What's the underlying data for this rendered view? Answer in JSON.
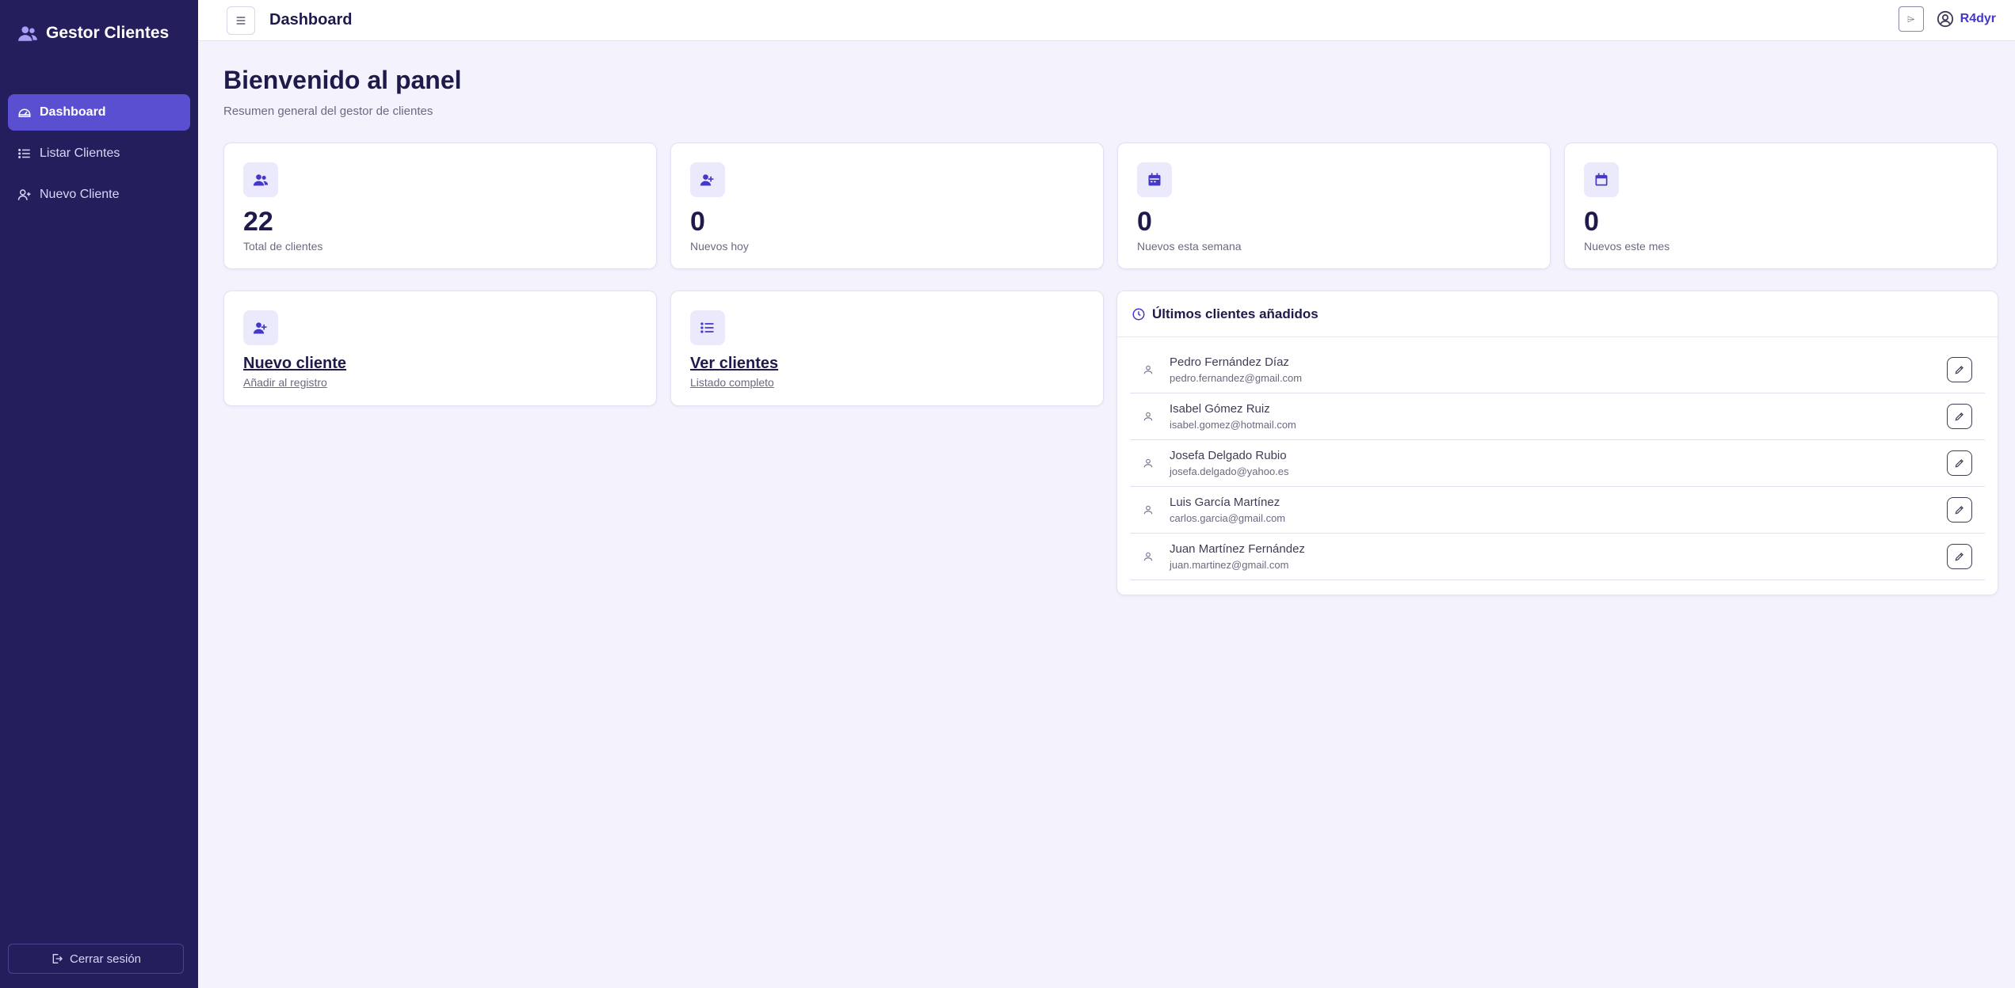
{
  "app": {
    "brand": "Gestor Clientes"
  },
  "sidebar": {
    "items": [
      {
        "label": "Dashboard",
        "icon": "dashboard-icon",
        "active": true
      },
      {
        "label": "Listar Clientes",
        "icon": "list-icon",
        "active": false
      },
      {
        "label": "Nuevo Cliente",
        "icon": "user-plus-icon",
        "active": false
      }
    ],
    "logout_label": "Cerrar sesión"
  },
  "topbar": {
    "title": "Dashboard",
    "small_button_label": "⌲",
    "user_name": "R4dyr"
  },
  "main": {
    "title": "Bienvenido al panel",
    "subtitle": "Resumen general del gestor de clientes",
    "stats": [
      {
        "value": "22",
        "label": "Total de clientes",
        "icon": "users-icon"
      },
      {
        "value": "0",
        "label": "Nuevos hoy",
        "icon": "user-plus-icon"
      },
      {
        "value": "0",
        "label": "Nuevos esta semana",
        "icon": "calendar-week-icon"
      },
      {
        "value": "0",
        "label": "Nuevos este mes",
        "icon": "calendar-month-icon"
      }
    ],
    "actions": [
      {
        "title": "Nuevo cliente",
        "subtitle": "Añadir al registro",
        "icon": "user-plus-icon"
      },
      {
        "title": "Ver clientes",
        "subtitle": "Listado completo",
        "icon": "list-icon"
      }
    ],
    "recent": {
      "title": "Últimos clientes añadidos",
      "clients": [
        {
          "name": "Pedro Fernández Díaz",
          "email": "pedro.fernandez@gmail.com"
        },
        {
          "name": "Isabel Gómez Ruiz",
          "email": "isabel.gomez@hotmail.com"
        },
        {
          "name": "Josefa Delgado Rubio",
          "email": "josefa.delgado@yahoo.es"
        },
        {
          "name": "Luis García Martínez",
          "email": "carlos.garcia@gmail.com"
        },
        {
          "name": "Juan Martínez Fernández",
          "email": "juan.martinez@gmail.com"
        }
      ]
    }
  },
  "colors": {
    "sidebar": "#241f5c",
    "accent": "#5b4fd1",
    "background": "#f3f2fd"
  }
}
